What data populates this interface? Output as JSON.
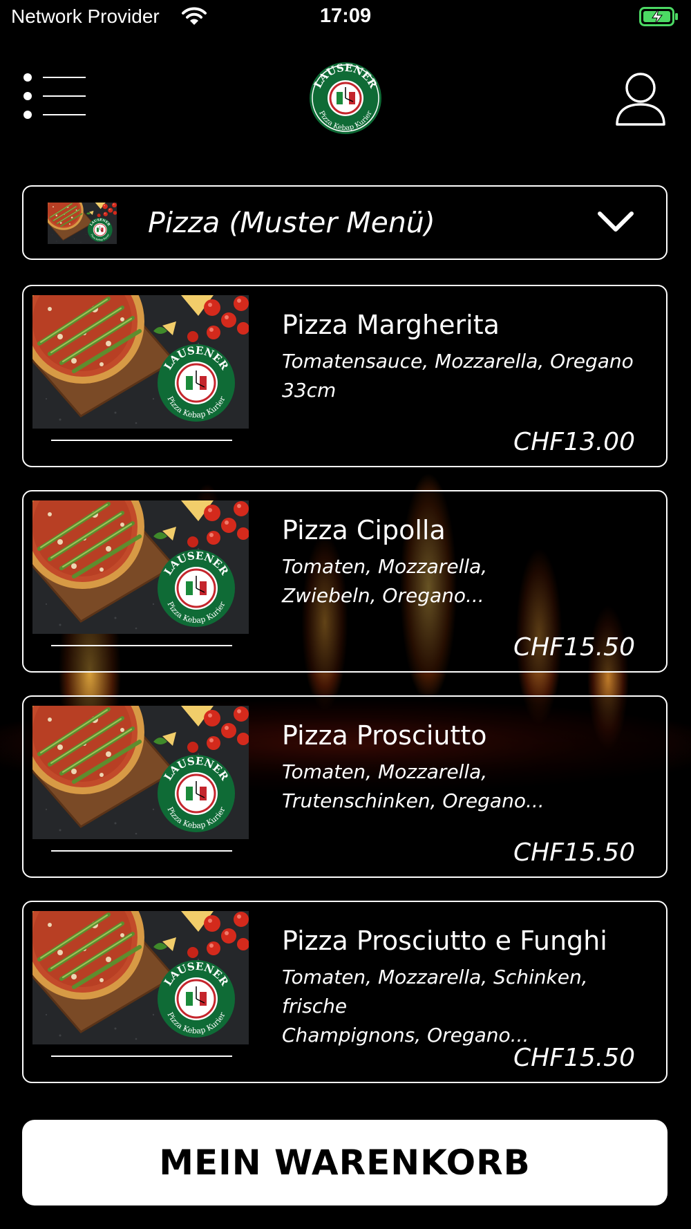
{
  "status_bar": {
    "carrier": "Network Provider",
    "time": "17:09"
  },
  "header": {
    "logo_text_top": "LAUSENER",
    "logo_text_bottom": "Pizza Kebap Kurier",
    "menu_icon": "hamburger-menu-icon",
    "profile_icon": "user-profile-icon"
  },
  "category": {
    "selected": "Pizza (Muster Menü)"
  },
  "products": [
    {
      "name": "Pizza Margherita",
      "desc_line1": "Tomatensauce, Mozzarella, Oregano",
      "desc_line2": "33cm",
      "price": "CHF13.00"
    },
    {
      "name": "Pizza Cipolla",
      "desc_line1": "Tomaten, Mozzarella,",
      "desc_line2": "Zwiebeln, Oregano...",
      "price": "CHF15.50"
    },
    {
      "name": "Pizza Prosciutto",
      "desc_line1": "Tomaten, Mozzarella,",
      "desc_line2": "Trutenschinken, Oregano...",
      "price": "CHF15.50"
    },
    {
      "name": "Pizza Prosciutto e Funghi",
      "desc_line1": "Tomaten, Mozzarella, Schinken, frische",
      "desc_line2": "Champignons, Oregano...",
      "price": "CHF15.50"
    }
  ],
  "cart_button": {
    "label": "MEIN WARENKORB"
  },
  "colors": {
    "background": "#000000",
    "logo_green": "#0f6b36",
    "logo_red": "#c4252c",
    "battery_green": "#4cd964"
  }
}
